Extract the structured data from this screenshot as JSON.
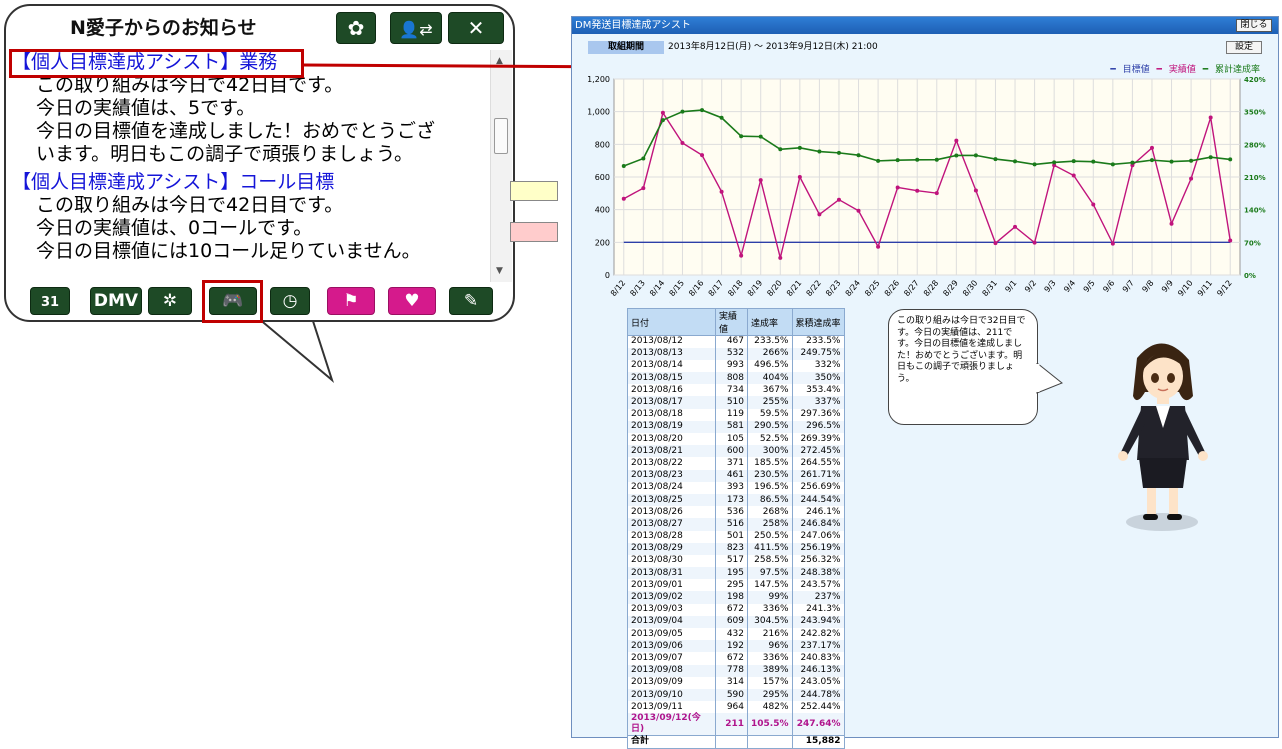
{
  "notification": {
    "title": "N愛子からのお知らせ",
    "messages": [
      {
        "title": "【個人目標達成アシスト】業務",
        "lines": [
          "この取り組みは今日で42日目です。",
          "今日の実績値は、5です。",
          "今日の目標値を達成しました！おめでとうござ",
          "います。明日もこの調子で頑張りましょう。"
        ]
      },
      {
        "title": "【個人目標達成アシスト】コール目標",
        "lines": [
          "この取り組みは今日で42日目です。",
          "今日の実績値は、0コールです。",
          "今日の目標値には10コール足りていません。"
        ]
      }
    ],
    "bottom_buttons": [
      "31",
      "DMV"
    ],
    "swatch_colors": [
      "#ffffc8",
      "#ffcccc"
    ],
    "highlight_color": "#c00000"
  },
  "window": {
    "title": "DM発送目標達成アシスト",
    "close_label": "閉じる",
    "period_label": "取組期間",
    "period_value": "2013年8月12日(月) ～ 2013年9月12日(木) 21:00",
    "settings_label": "設定",
    "speech": "この取り組みは今日で32日目です。今日の実績値は、211です。今日の目標値を達成しました！おめでとうございます。明日もこの調子で頑張りましょう。"
  },
  "chart_data": {
    "type": "line",
    "categories": [
      "8/12",
      "8/13",
      "8/14",
      "8/15",
      "8/16",
      "8/17",
      "8/18",
      "8/19",
      "8/20",
      "8/21",
      "8/22",
      "8/23",
      "8/24",
      "8/25",
      "8/26",
      "8/27",
      "8/28",
      "8/29",
      "8/30",
      "8/31",
      "9/1",
      "9/2",
      "9/3",
      "9/4",
      "9/5",
      "9/6",
      "9/7",
      "9/8",
      "9/9",
      "9/10",
      "9/11",
      "9/12"
    ],
    "series": [
      {
        "name": "目標値",
        "axis": "left",
        "color": "#2d3fa8",
        "values": [
          200,
          200,
          200,
          200,
          200,
          200,
          200,
          200,
          200,
          200,
          200,
          200,
          200,
          200,
          200,
          200,
          200,
          200,
          200,
          200,
          200,
          200,
          200,
          200,
          200,
          200,
          200,
          200,
          200,
          200,
          200,
          200
        ]
      },
      {
        "name": "実績値",
        "axis": "left",
        "color": "#c0147c",
        "values": [
          467,
          532,
          993,
          808,
          734,
          510,
          119,
          581,
          105,
          600,
          371,
          461,
          393,
          173,
          536,
          516,
          501,
          823,
          517,
          195,
          295,
          198,
          672,
          609,
          432,
          192,
          672,
          778,
          314,
          590,
          964,
          211
        ]
      },
      {
        "name": "累計達成率",
        "axis": "right",
        "color": "#1a7a1a",
        "values": [
          233.5,
          249.75,
          332,
          350,
          353.4,
          337,
          297.36,
          296.5,
          269.39,
          272.45,
          264.55,
          261.71,
          256.69,
          244.54,
          246.1,
          246.84,
          247.06,
          256.19,
          256.32,
          248.38,
          243.57,
          237,
          241.3,
          243.94,
          242.82,
          237.17,
          240.83,
          246.13,
          243.05,
          244.78,
          252.44,
          247.64
        ]
      }
    ],
    "ylim": [
      0,
      1200
    ],
    "yticks": [
      "0",
      "200",
      "400",
      "600",
      "800",
      "1,000",
      "1,200"
    ],
    "y2lim": [
      0,
      420
    ],
    "y2ticks": [
      "0%",
      "70%",
      "140%",
      "210%",
      "280%",
      "350%",
      "420%"
    ],
    "grid": true,
    "legend": "top-right"
  },
  "table": {
    "headers": [
      "日付",
      "実績値",
      "達成率",
      "累積達成率"
    ],
    "rows": [
      [
        "2013/08/12",
        "467",
        "233.5%",
        "233.5%"
      ],
      [
        "2013/08/13",
        "532",
        "266%",
        "249.75%"
      ],
      [
        "2013/08/14",
        "993",
        "496.5%",
        "332%"
      ],
      [
        "2013/08/15",
        "808",
        "404%",
        "350%"
      ],
      [
        "2013/08/16",
        "734",
        "367%",
        "353.4%"
      ],
      [
        "2013/08/17",
        "510",
        "255%",
        "337%"
      ],
      [
        "2013/08/18",
        "119",
        "59.5%",
        "297.36%"
      ],
      [
        "2013/08/19",
        "581",
        "290.5%",
        "296.5%"
      ],
      [
        "2013/08/20",
        "105",
        "52.5%",
        "269.39%"
      ],
      [
        "2013/08/21",
        "600",
        "300%",
        "272.45%"
      ],
      [
        "2013/08/22",
        "371",
        "185.5%",
        "264.55%"
      ],
      [
        "2013/08/23",
        "461",
        "230.5%",
        "261.71%"
      ],
      [
        "2013/08/24",
        "393",
        "196.5%",
        "256.69%"
      ],
      [
        "2013/08/25",
        "173",
        "86.5%",
        "244.54%"
      ],
      [
        "2013/08/26",
        "536",
        "268%",
        "246.1%"
      ],
      [
        "2013/08/27",
        "516",
        "258%",
        "246.84%"
      ],
      [
        "2013/08/28",
        "501",
        "250.5%",
        "247.06%"
      ],
      [
        "2013/08/29",
        "823",
        "411.5%",
        "256.19%"
      ],
      [
        "2013/08/30",
        "517",
        "258.5%",
        "256.32%"
      ],
      [
        "2013/08/31",
        "195",
        "97.5%",
        "248.38%"
      ],
      [
        "2013/09/01",
        "295",
        "147.5%",
        "243.57%"
      ],
      [
        "2013/09/02",
        "198",
        "99%",
        "237%"
      ],
      [
        "2013/09/03",
        "672",
        "336%",
        "241.3%"
      ],
      [
        "2013/09/04",
        "609",
        "304.5%",
        "243.94%"
      ],
      [
        "2013/09/05",
        "432",
        "216%",
        "242.82%"
      ],
      [
        "2013/09/06",
        "192",
        "96%",
        "237.17%"
      ],
      [
        "2013/09/07",
        "672",
        "336%",
        "240.83%"
      ],
      [
        "2013/09/08",
        "778",
        "389%",
        "246.13%"
      ],
      [
        "2013/09/09",
        "314",
        "157%",
        "243.05%"
      ],
      [
        "2013/09/10",
        "590",
        "295%",
        "244.78%"
      ],
      [
        "2013/09/11",
        "964",
        "482%",
        "252.44%"
      ]
    ],
    "today_row": [
      "2013/09/12(今日)",
      "211",
      "105.5%",
      "247.64%"
    ],
    "total_label": "合計",
    "total_value": "15,882"
  }
}
